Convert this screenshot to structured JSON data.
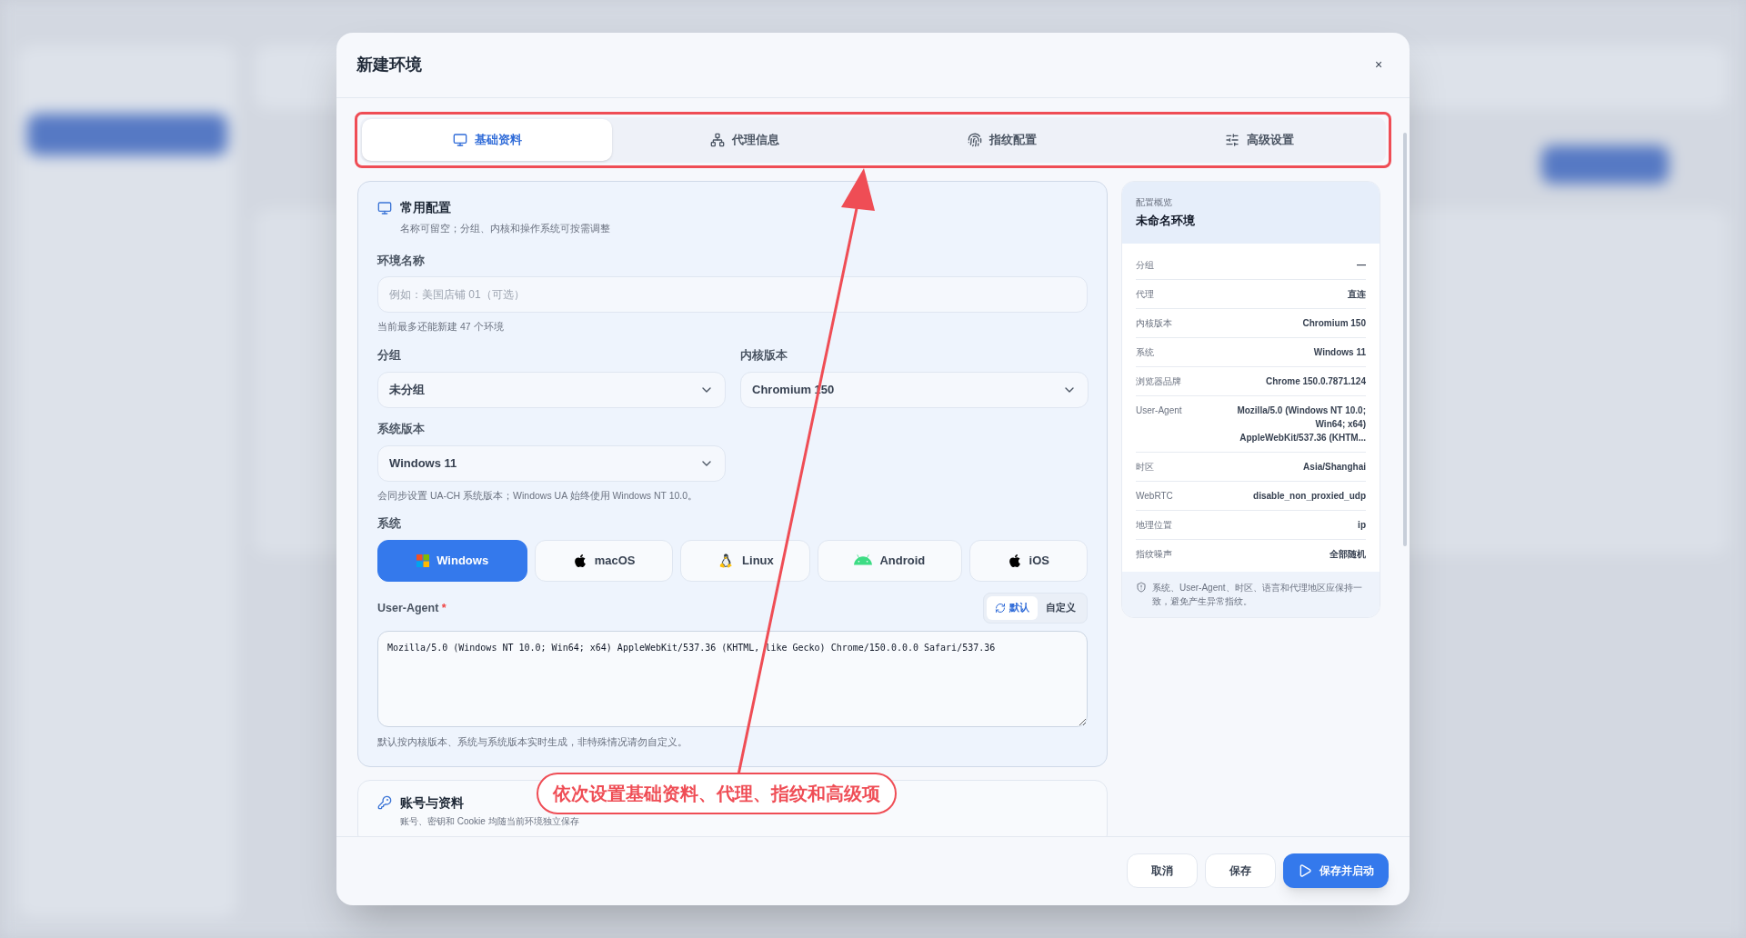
{
  "dialog": {
    "title": "新建环境",
    "close": "×"
  },
  "tabs": [
    {
      "label": "基础资料",
      "kind": "monitor",
      "selected": true
    },
    {
      "label": "代理信息",
      "kind": "network",
      "selected": false
    },
    {
      "label": "指纹配置",
      "kind": "fingerprint",
      "selected": false
    },
    {
      "label": "高级设置",
      "kind": "sliders",
      "selected": false
    }
  ],
  "common_section": {
    "title": "常用配置",
    "subtitle": "名称可留空；分组、内核和操作系统可按需调整",
    "name_field": {
      "label": "环境名称",
      "placeholder": "例如：美国店铺 01（可选）",
      "hint": "当前最多还能新建 47 个环境"
    },
    "group": {
      "label": "分组",
      "value": "未分组"
    },
    "kernel": {
      "label": "内核版本",
      "value": "Chromium 150"
    },
    "os_version": {
      "label": "系统版本",
      "value": "Windows 11",
      "hint": "会同步设置 UA-CH 系统版本；Windows UA 始终使用 Windows NT 10.0。"
    },
    "system": {
      "label": "系统",
      "options": [
        {
          "label": "Windows",
          "kind": "windows",
          "selected": true
        },
        {
          "label": "macOS",
          "kind": "apple",
          "selected": false
        },
        {
          "label": "Linux",
          "kind": "linux",
          "selected": false
        },
        {
          "label": "Android",
          "kind": "android",
          "selected": false
        },
        {
          "label": "iOS",
          "kind": "apple",
          "selected": false
        }
      ]
    },
    "user_agent": {
      "label": "User-Agent",
      "required": "*",
      "modes": [
        {
          "label": "默认",
          "selected": true
        },
        {
          "label": "自定义",
          "selected": false
        }
      ],
      "value": "Mozilla/5.0 (Windows NT 10.0; Win64; x64) AppleWebKit/537.36 (KHTML, like Gecko) Chrome/150.0.0.0 Safari/537.36",
      "hint": "默认按内核版本、系统与系统版本实时生成，非特殊情况请勿自定义。"
    }
  },
  "account_section": {
    "title": "账号与资料",
    "subtitle": "账号、密钥和 Cookie 均随当前环境独立保存"
  },
  "summary": {
    "caption": "配置概览",
    "title": "未命名环境",
    "rows": [
      {
        "label": "分组",
        "value": "—"
      },
      {
        "label": "代理",
        "value": "直连"
      },
      {
        "label": "内核版本",
        "value": "Chromium 150"
      },
      {
        "label": "系统",
        "value": "Windows 11"
      },
      {
        "label": "浏览器品牌",
        "value": "Chrome 150.0.7871.124"
      },
      {
        "label": "User-Agent",
        "value": "Mozilla/5.0 (Windows NT 10.0; Win64; x64) AppleWebKit/537.36 (KHTM..."
      },
      {
        "label": "时区",
        "value": "Asia/Shanghai"
      },
      {
        "label": "WebRTC",
        "value": "disable_non_proxied_udp"
      },
      {
        "label": "地理位置",
        "value": "ip"
      },
      {
        "label": "指纹噪声",
        "value": "全部随机"
      }
    ],
    "note": "系统、User-Agent、时区、语言和代理地区应保持一致，避免产生异常指纹。"
  },
  "buttons": [
    {
      "label": "取消",
      "kind": "secondary"
    },
    {
      "label": "保存",
      "kind": "secondary"
    },
    {
      "label": "保存并启动",
      "kind": "primary"
    }
  ],
  "annotation": {
    "text": "依次设置基础资料、代理、指纹和高级项"
  }
}
